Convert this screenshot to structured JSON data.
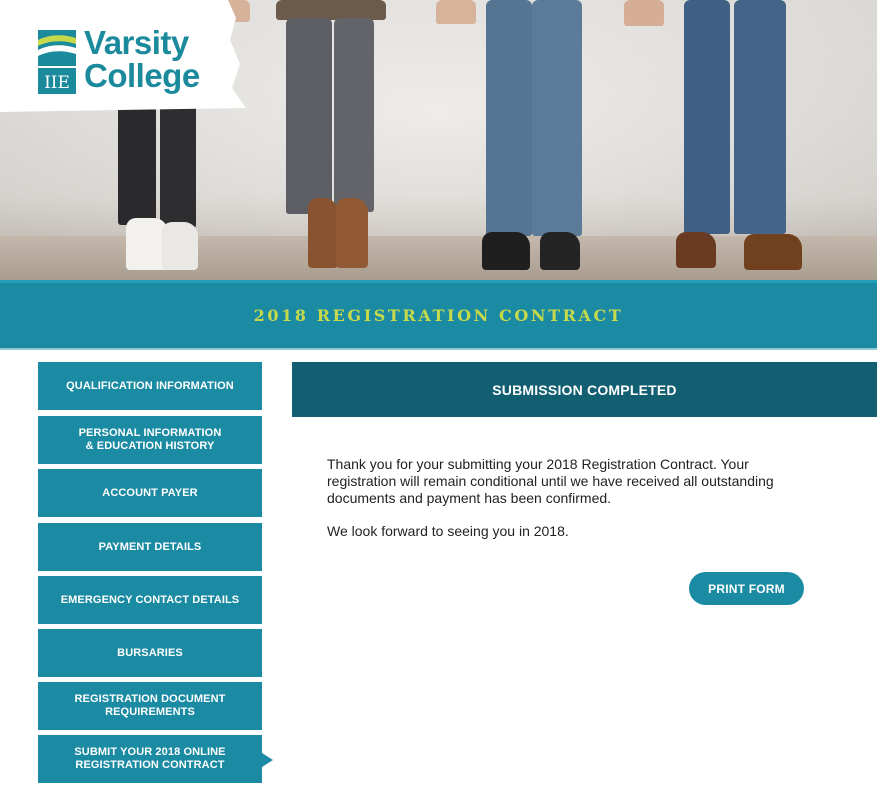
{
  "logo": {
    "line1": "Varsity",
    "line2": "College",
    "mark_text": "IIE"
  },
  "banner": {
    "title": "2018 REGISTRATION CONTRACT"
  },
  "sidebar": {
    "items": [
      {
        "line1": "QUALIFICATION INFORMATION",
        "line2": ""
      },
      {
        "line1": "PERSONAL INFORMATION",
        "line2": "& EDUCATION HISTORY"
      },
      {
        "line1": "ACCOUNT PAYER",
        "line2": ""
      },
      {
        "line1": "PAYMENT DETAILS",
        "line2": ""
      },
      {
        "line1": "EMERGENCY CONTACT DETAILS",
        "line2": ""
      },
      {
        "line1": "BURSARIES",
        "line2": ""
      },
      {
        "line1": "REGISTRATION DOCUMENT",
        "line2": "REQUIREMENTS"
      },
      {
        "line1": "SUBMIT YOUR 2018 ONLINE",
        "line2": "REGISTRATION CONTRACT"
      }
    ],
    "active_index": 7
  },
  "main": {
    "header": "SUBMISSION COMPLETED",
    "paragraph1": "Thank you for your submitting your 2018 Registration Contract. Your registration will remain conditional until we have received all outstanding documents and payment has been confirmed.",
    "paragraph2": "We look forward to seeing you in 2018.",
    "print_label": "PRINT FORM"
  },
  "colors": {
    "teal": "#1b8aa3",
    "dark_teal": "#135f72",
    "lime": "#c6d94b"
  }
}
